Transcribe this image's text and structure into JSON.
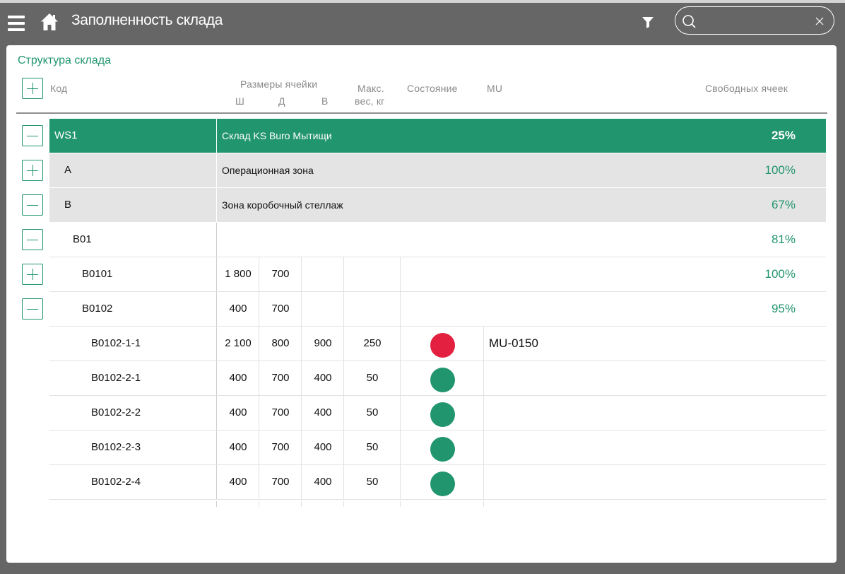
{
  "app": {
    "title": "Заполненность склада"
  },
  "search": {
    "placeholder": "",
    "value": ""
  },
  "colors": {
    "accent": "#21956d",
    "status_busy": "#e3203f",
    "status_free": "#21956d"
  },
  "icons": [
    "menu-icon",
    "home-icon",
    "filter-icon",
    "search-icon",
    "clear-icon",
    "plus-icon",
    "minus-icon"
  ],
  "panel": {
    "title": "Структура склада"
  },
  "columns": {
    "code": "Код",
    "sizes": "Размеры ячейки",
    "w": "Ш",
    "d": "Д",
    "h": "В",
    "max_weight_line1": "Макс.",
    "max_weight_line2": "вес, кг",
    "state": "Состояние",
    "mu": "MU",
    "free": "Свободных ячеек"
  },
  "rows": [
    {
      "code": "WS1",
      "name": "Склад KS Buro Мытищи",
      "free": "25%",
      "toggle": "minus"
    },
    {
      "code": "A",
      "name": "Операционная зона",
      "free": "100%",
      "toggle": "plus"
    },
    {
      "code": "B",
      "name": "Зона коробочный стеллаж",
      "free": "67%",
      "toggle": "minus"
    },
    {
      "code": "B01",
      "free": "81%",
      "toggle": "minus"
    },
    {
      "code": "B0101",
      "w": "1 800",
      "d": "700",
      "free": "100%",
      "toggle": "plus"
    },
    {
      "code": "B0102",
      "w": "400",
      "d": "700",
      "free": "95%",
      "toggle": "minus"
    },
    {
      "code": "B0102-1-1",
      "w": "2 100",
      "d": "800",
      "h": "900",
      "max_weight": "250",
      "state": "busy",
      "mu": "MU-0150"
    },
    {
      "code": "B0102-2-1",
      "w": "400",
      "d": "700",
      "h": "400",
      "max_weight": "50",
      "state": "free",
      "mu": ""
    },
    {
      "code": "B0102-2-2",
      "w": "400",
      "d": "700",
      "h": "400",
      "max_weight": "50",
      "state": "free",
      "mu": ""
    },
    {
      "code": "B0102-2-3",
      "w": "400",
      "d": "700",
      "h": "400",
      "max_weight": "50",
      "state": "free",
      "mu": ""
    },
    {
      "code": "B0102-2-4",
      "w": "400",
      "d": "700",
      "h": "400",
      "max_weight": "50",
      "state": "free",
      "mu": ""
    }
  ]
}
